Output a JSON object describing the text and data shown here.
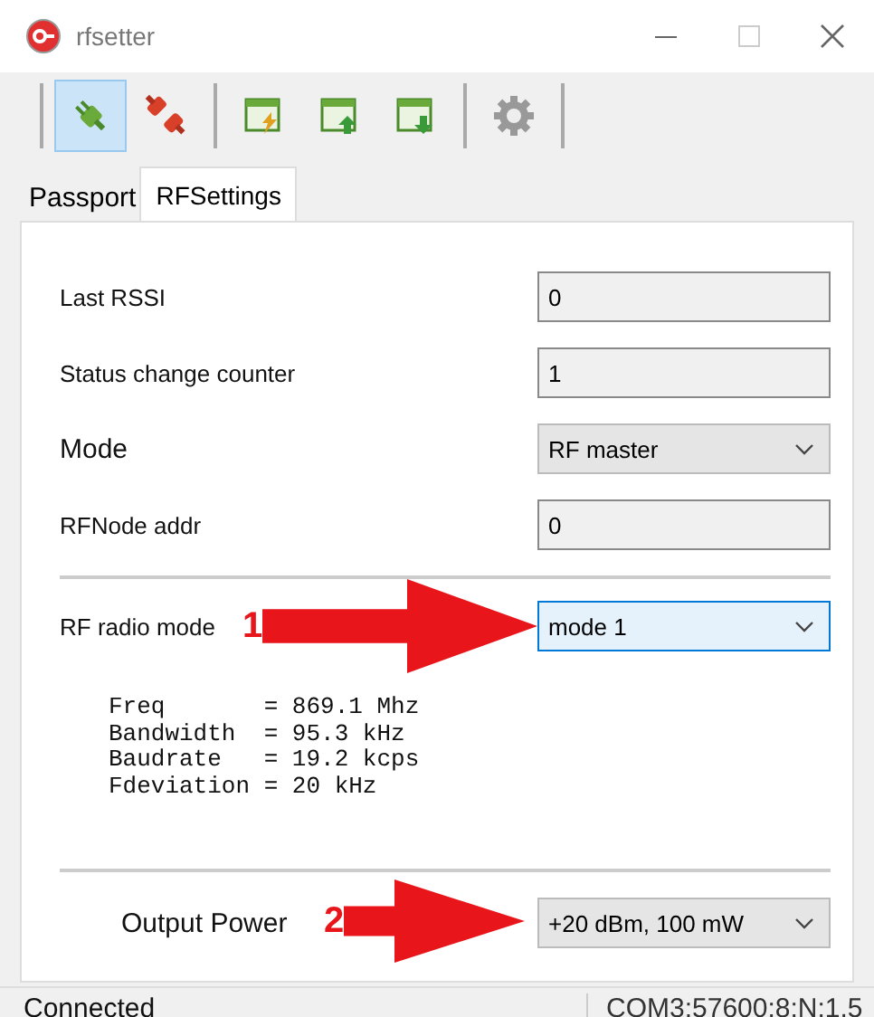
{
  "window": {
    "title": "rfsetter"
  },
  "toolbar": [
    [
      {
        "kind": "connect",
        "selected": true
      },
      {
        "kind": "disconnect",
        "selected": false
      }
    ],
    [
      {
        "kind": "window-flash",
        "selected": false
      },
      {
        "kind": "window-upload",
        "selected": false
      },
      {
        "kind": "window-download",
        "selected": false
      }
    ],
    [
      {
        "kind": "settings",
        "selected": false
      }
    ]
  ],
  "tabs": [
    {
      "label": "Passport",
      "selected": false
    },
    {
      "label": "RFSettings",
      "selected": true
    }
  ],
  "fields": [
    {
      "label": "Last RSSI",
      "kind": "text",
      "value": "0"
    },
    {
      "label": "Status change counter",
      "kind": "text",
      "value": "1"
    },
    {
      "label": "Mode",
      "kind": "dropdown",
      "value": "RF master",
      "focused": false
    },
    {
      "label": "RFNode addr",
      "kind": "text",
      "value": "0"
    }
  ],
  "radio": {
    "label": "RF radio mode",
    "value": "mode 1",
    "focused": true,
    "annotation": "1",
    "info": [
      "Freq       = 869.1 Mhz",
      "Bandwidth  = 95.3 kHz",
      "Baudrate   = 19.2 kcps",
      "Fdeviation = 20 kHz"
    ]
  },
  "output": {
    "label": "Output Power",
    "value": "+20 dBm, 100 mW",
    "focused": false,
    "annotation": "2"
  },
  "status_bar": {
    "left": "Connected",
    "right": "COM3:57600:8:N:1.5"
  }
}
